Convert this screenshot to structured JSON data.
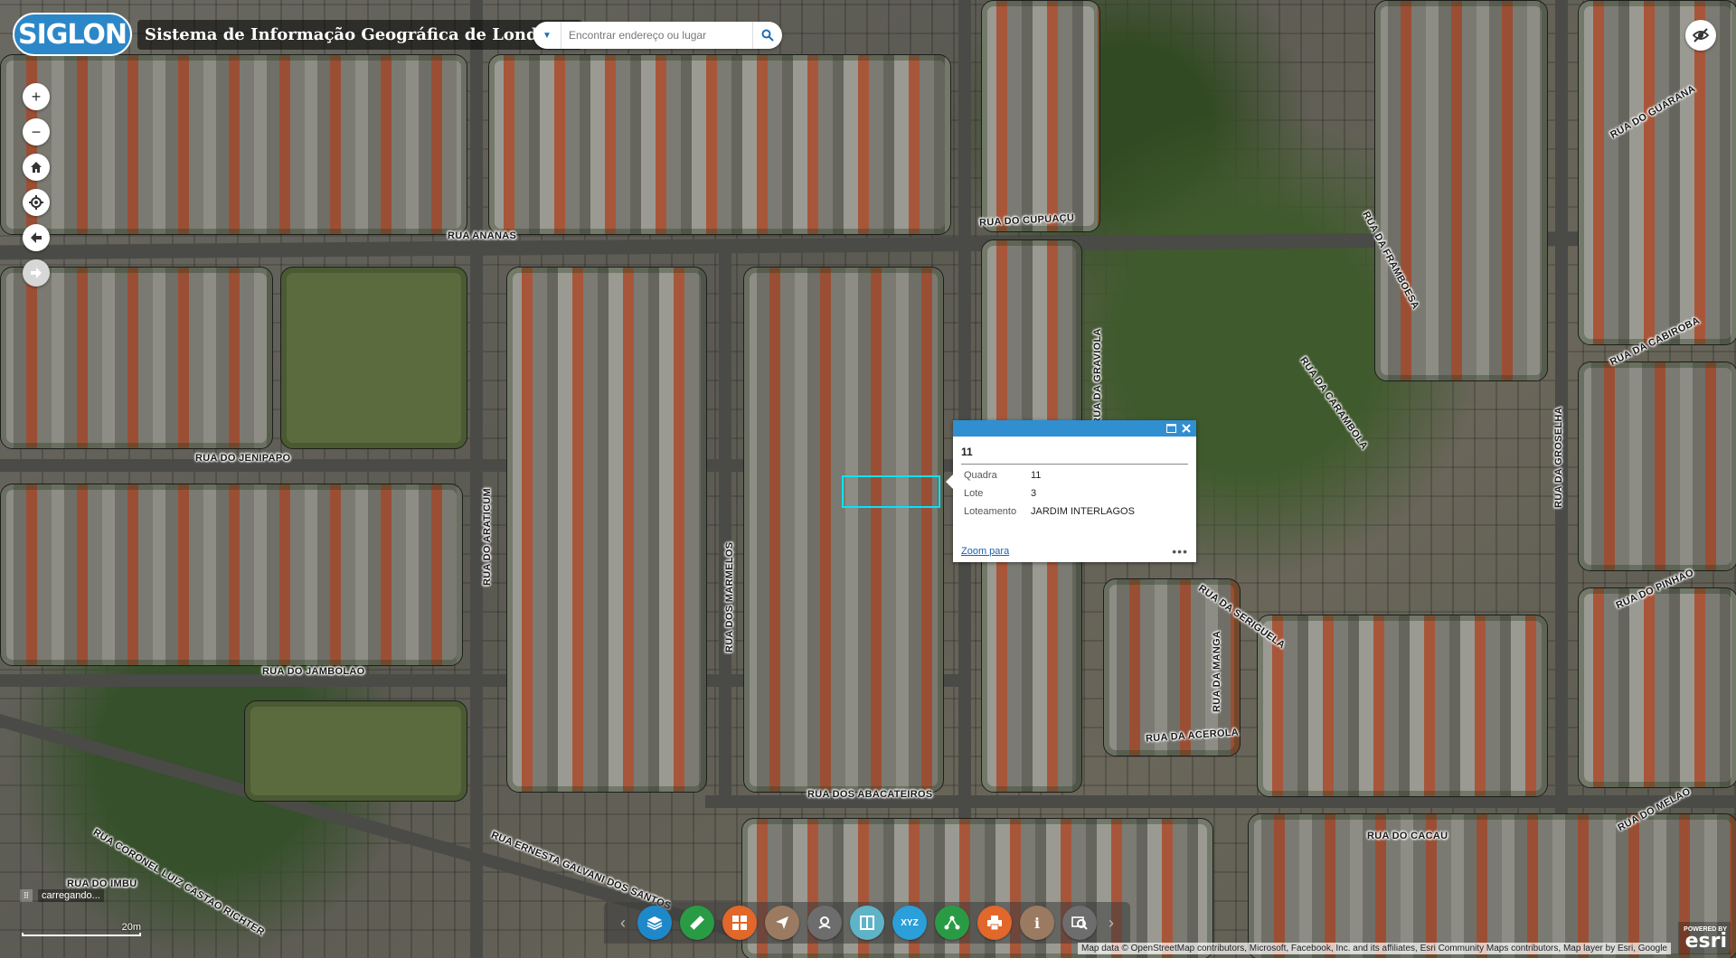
{
  "header": {
    "logo_text": "SIGLON",
    "title": "Sistema de Informação Geográfica de Londrina"
  },
  "search": {
    "placeholder": "Encontrar endereço ou lugar"
  },
  "map_controls": {
    "zoom_in": "+",
    "zoom_out": "−"
  },
  "streets": [
    "RUA ANANAS",
    "RUA DO CUPUAÇU",
    "RUA DO GUARANA",
    "RUA DA FRAMBOESA",
    "RUA DA CABIROBA",
    "RUA DA CARAMBOLA",
    "RUA DA GRAVIOLA",
    "RUA DO JENIPAPO",
    "RUA DO ARATICUM",
    "RUA DOS MARMELOS",
    "RUA DA GROSELHA",
    "RUA DO PINHAO",
    "RUA DA SERIGUELA",
    "RUA DA MANGA",
    "RUA DO JAMBOLAO",
    "RUA DA ACEROLA",
    "RUA DOS ABACATEIROS",
    "RUA DO MELAO",
    "RUA DO CACAU",
    "RUA ERNESTA GALVANI DOS SANTOS",
    "RUA CORONEL LUIZ CASTAO RICHTER",
    "RUA DO IMBU"
  ],
  "popup": {
    "title": "11",
    "attributes": [
      {
        "key": "Quadra",
        "value": "11"
      },
      {
        "key": "Lote",
        "value": "3"
      },
      {
        "key": "Loteamento",
        "value": "JARDIM INTERLAGOS"
      }
    ],
    "zoom_link": "Zoom para",
    "more": "•••"
  },
  "toolbar": {
    "tools": [
      {
        "icon": "layers-icon",
        "color": "#1f88c9"
      },
      {
        "icon": "measure-ruler-icon",
        "color": "#2a9b45"
      },
      {
        "icon": "basemap-gallery-icon",
        "color": "#e2672a"
      },
      {
        "icon": "directions-icon",
        "color": "#9a7b62"
      },
      {
        "icon": "geolocate-icon",
        "color": "#6d6d6d"
      },
      {
        "icon": "swipe-icon",
        "color": "#5fb3c7"
      },
      {
        "icon": "coordinate-xyz-icon",
        "color": "#2a9fd9"
      },
      {
        "icon": "share-icon",
        "color": "#2a9b45"
      },
      {
        "icon": "print-icon",
        "color": "#e2672a"
      },
      {
        "icon": "info-icon",
        "color": "#9a7b62"
      },
      {
        "icon": "query-icon",
        "color": "#6d6d6d"
      }
    ],
    "xyz_label": "XYZ"
  },
  "status": {
    "loading_text": "carregando..."
  },
  "scale": {
    "label": "20m"
  },
  "attribution": "Map data © OpenStreetMap contributors, Microsoft, Facebook, Inc. and its affiliates, Esri Community Maps contributors, Map layer by Esri, Google",
  "esri": {
    "powered_by": "POWERED BY",
    "brand": "esri"
  }
}
